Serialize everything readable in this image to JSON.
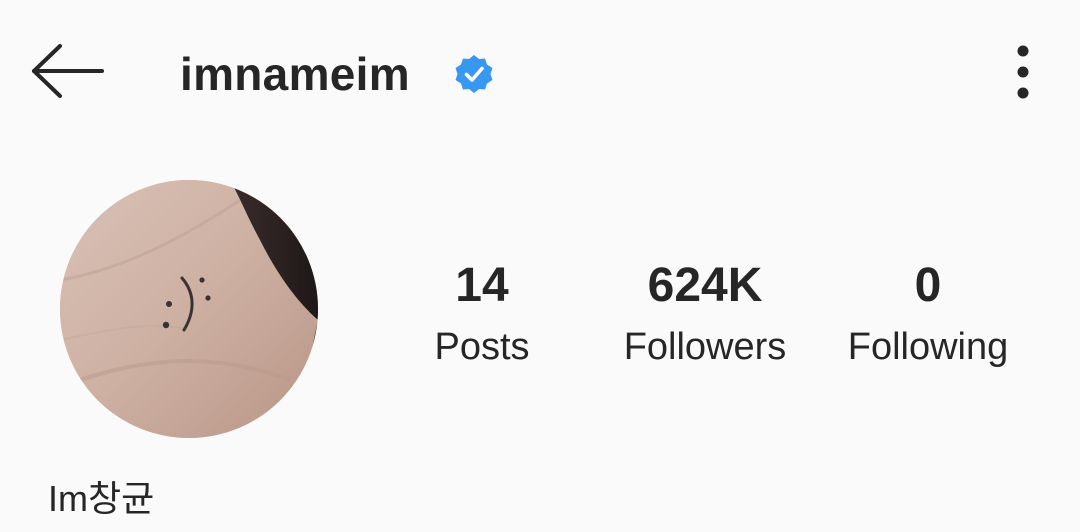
{
  "header": {
    "back_icon": "arrow-left-icon",
    "username": "imnameim",
    "verified_icon": "verified-badge-icon",
    "verified_color": "#3897f0",
    "more_icon": "more-vertical-icon"
  },
  "profile": {
    "avatar_alt": "profile picture",
    "display_name": "Im창균"
  },
  "stats": {
    "posts": {
      "value": "14",
      "label": "Posts"
    },
    "followers": {
      "value": "624K",
      "label": "Followers"
    },
    "following": {
      "value": "0",
      "label": "Following"
    }
  }
}
